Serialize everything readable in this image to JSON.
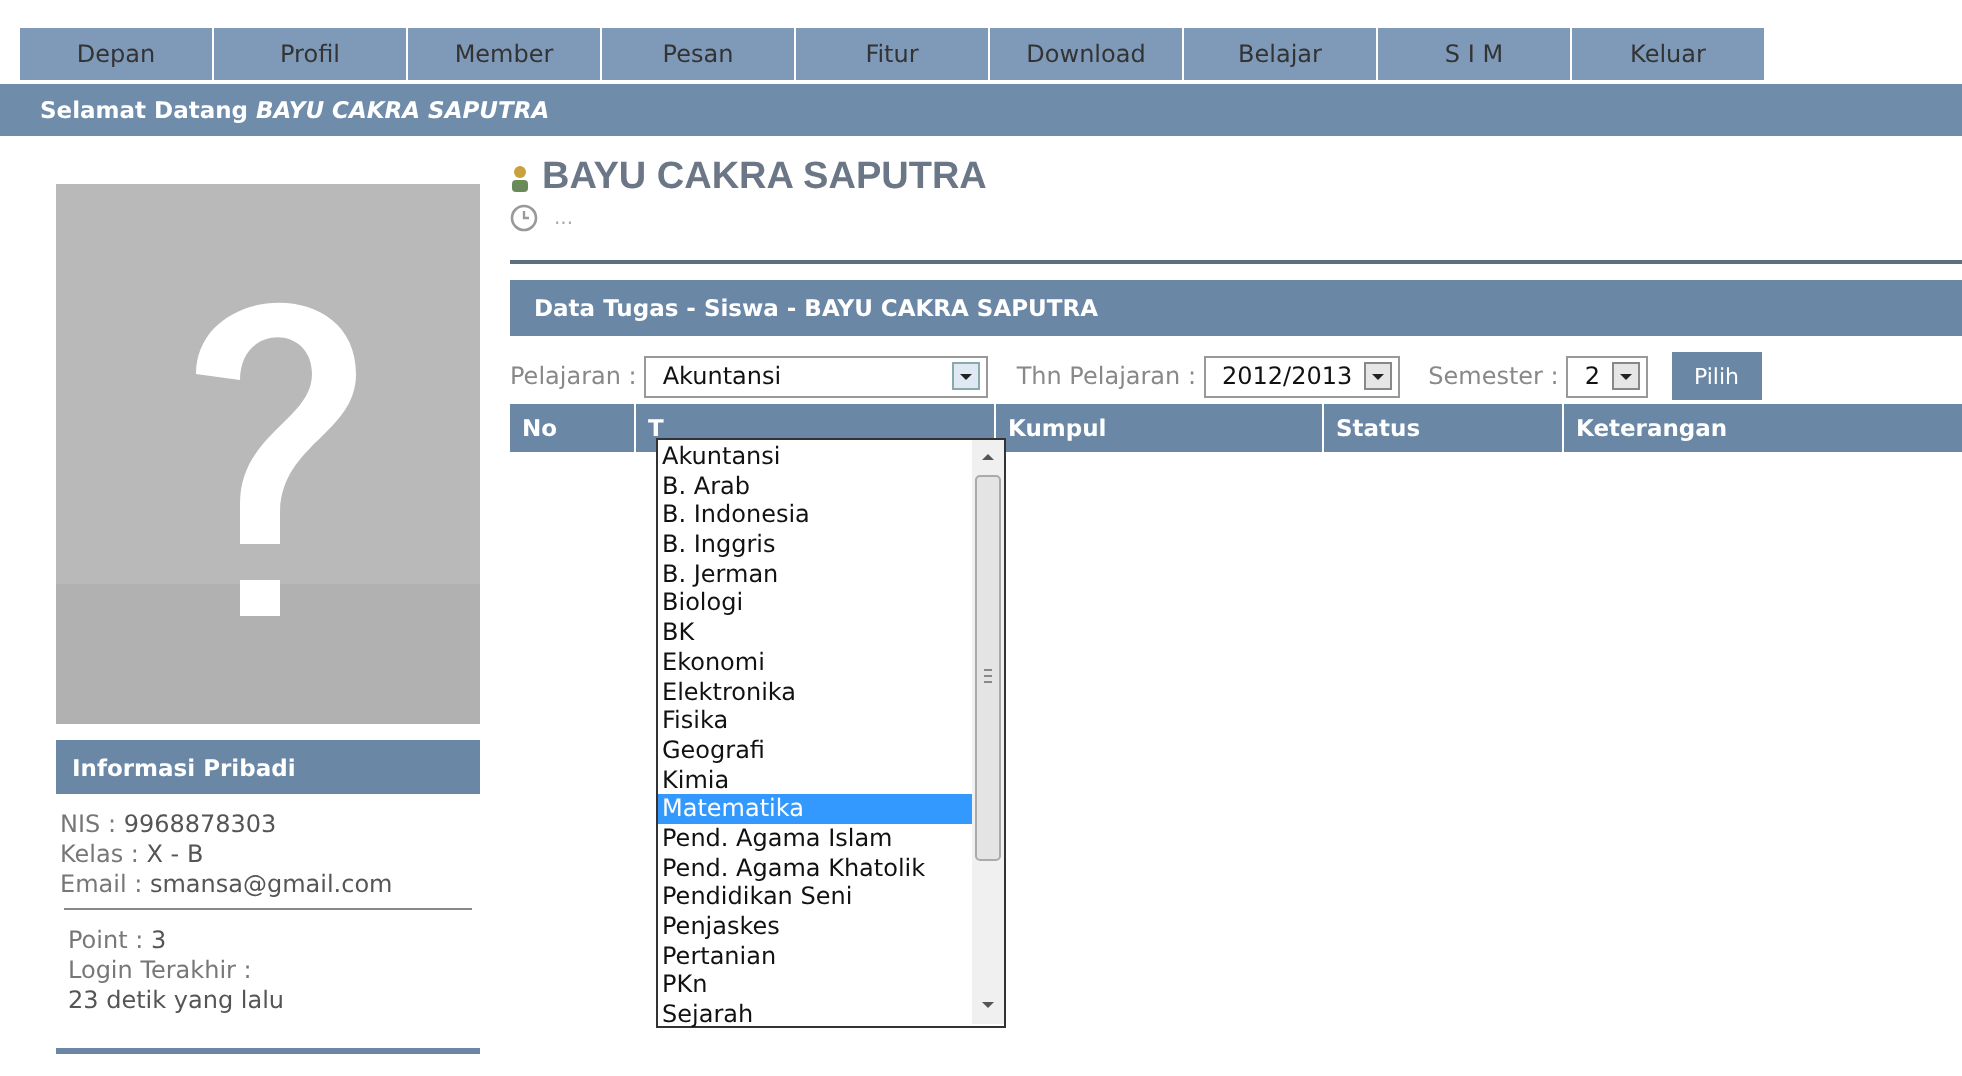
{
  "nav": [
    "Depan",
    "Profil",
    "Member",
    "Pesan",
    "Fitur",
    "Download",
    "Belajar",
    "S I M",
    "Keluar"
  ],
  "welcome": {
    "label": "Selamat Datang",
    "name": "BAYU CAKRA SAPUTRA"
  },
  "profile": {
    "info_title": "Informasi Pribadi",
    "info": [
      {
        "label": "NIS :",
        "value": "9968878303"
      },
      {
        "label": "Kelas :",
        "value": "X - B"
      },
      {
        "label": "Email :",
        "value": "smansa@gmail.com"
      }
    ],
    "stats": [
      {
        "label": "Point :",
        "value": "3"
      },
      {
        "label": "Login Terakhir :"
      }
    ],
    "last_login": "23 detik yang lalu"
  },
  "title": "BAYU CAKRA SAPUTRA",
  "subtitle": "...",
  "panel_title": "Data Tugas - Siswa - BAYU CAKRA SAPUTRA",
  "filters": {
    "subject_label": "Pelajaran :",
    "subject": "Akuntansi",
    "year_label": "Thn Pelajaran :",
    "year": "2012/2013",
    "semester_label": "Semester :",
    "semester": "2",
    "button": "Pilih"
  },
  "table": {
    "columns": [
      "No",
      "T",
      "Kumpul",
      "Status",
      "Keterangan"
    ]
  },
  "dropdown": [
    {
      "label": "Akuntansi",
      "selected": false
    },
    {
      "label": "B. Arab",
      "selected": false
    },
    {
      "label": "B. Indonesia",
      "selected": false
    },
    {
      "label": "B. Inggris",
      "selected": false
    },
    {
      "label": "B. Jerman",
      "selected": false
    },
    {
      "label": "Biologi",
      "selected": false
    },
    {
      "label": "BK",
      "selected": false
    },
    {
      "label": "Ekonomi",
      "selected": false
    },
    {
      "label": "Elektronika",
      "selected": false
    },
    {
      "label": "Fisika",
      "selected": false
    },
    {
      "label": "Geografi",
      "selected": false
    },
    {
      "label": "Kimia",
      "selected": false
    },
    {
      "label": "Matematika",
      "selected": true
    },
    {
      "label": "Pend. Agama Islam",
      "selected": false
    },
    {
      "label": "Pend. Agama Khatolik",
      "selected": false
    },
    {
      "label": "Pendidikan Seni",
      "selected": false
    },
    {
      "label": "Penjaskes",
      "selected": false
    },
    {
      "label": "Pertanian",
      "selected": false
    },
    {
      "label": "PKn",
      "selected": false
    },
    {
      "label": "Sejarah",
      "selected": false
    }
  ]
}
